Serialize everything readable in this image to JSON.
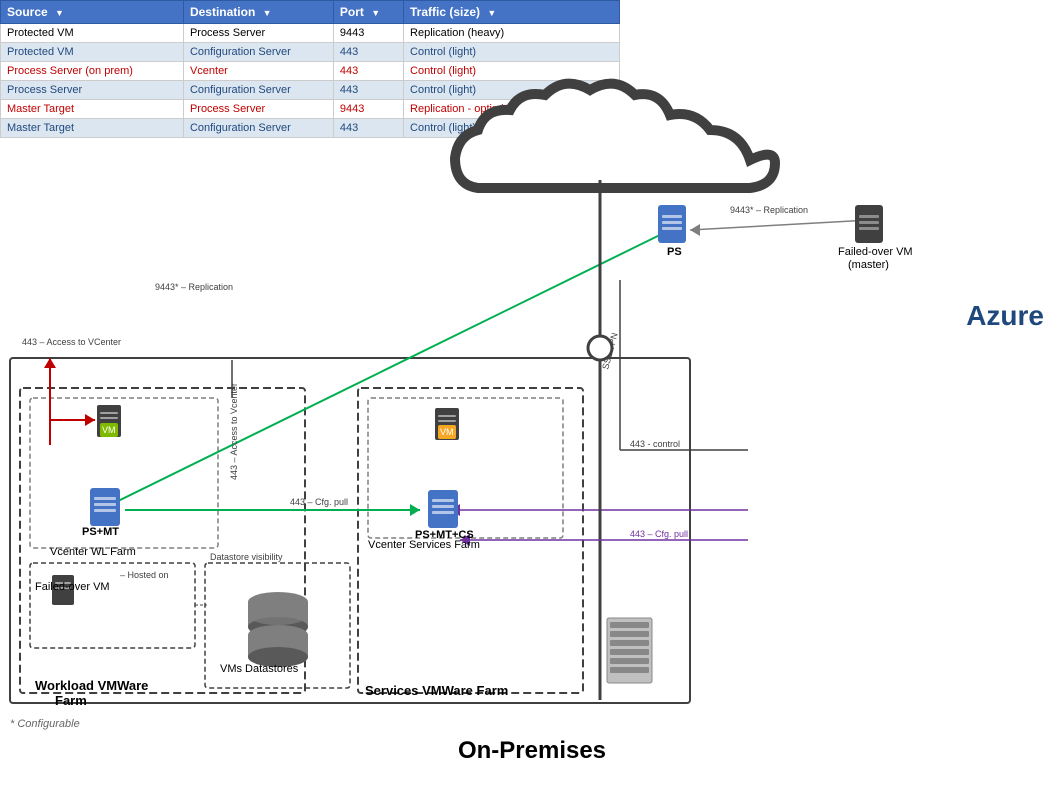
{
  "table": {
    "headers": [
      "Source",
      "Destination",
      "Port",
      "Traffic (size)"
    ],
    "rows": [
      {
        "source": "Protected VM",
        "destination": "Process Server",
        "port": "9443",
        "traffic": "Replication (heavy)",
        "style": "normal"
      },
      {
        "source": "Protected VM",
        "destination": "Configuration Server",
        "port": "443",
        "traffic": "Control (light)",
        "style": "alt"
      },
      {
        "source": "Process Server (on prem)",
        "destination": "Vcenter",
        "port": "443",
        "traffic": "Control (light)",
        "style": "red"
      },
      {
        "source": "Process Server",
        "destination": "Configuration Server",
        "port": "443",
        "traffic": "Control (light)",
        "style": "alt"
      },
      {
        "source": "Master Target",
        "destination": "Process Server",
        "port": "9443",
        "traffic": "Replication - optimized (heavy)",
        "style": "red"
      },
      {
        "source": "Master Target",
        "destination": "Configuration Server",
        "port": "443",
        "traffic": "Control (light)",
        "style": "alt"
      }
    ]
  },
  "diagram": {
    "azure_label": "Azure",
    "onprem_label": "On-Premises",
    "config_note": "* Configurable",
    "labels": {
      "ps_cloud": "PS",
      "failed_over_vm_cloud": "Failed-over VM\n(master)",
      "ps_mt": "PS+MT",
      "ps_mt_cs": "PS+MT+CS",
      "vcenter_wl_farm": "Vcenter WL Farm",
      "vcenter_svc_farm": "Vcenter Services Farm",
      "workload_vmware_farm": "Workload VMWare\nFarm",
      "services_vmware_farm": "Services VMWare Farm",
      "vms_datastores": "VMs Datastores",
      "failed_over_vm_onprem": "Failed-over VM",
      "datastore_visibility": "Datastore visibility",
      "hosted_on": "Hosted on"
    },
    "annotations": {
      "replication_9443": "9443* – Replication",
      "replication_9443_2": "9443* – Replication",
      "access_vcenter_443": "443 – Access to VCenter",
      "access_vcenter_443_2": "443 – Access to Vcenter",
      "cfg_pull_443": "443 – Cfg. pull",
      "cfg_pull_443_2": "443 – Cfg. pull",
      "control_443": "443 - control",
      "ssl_vpn": "SSL VPN"
    }
  }
}
